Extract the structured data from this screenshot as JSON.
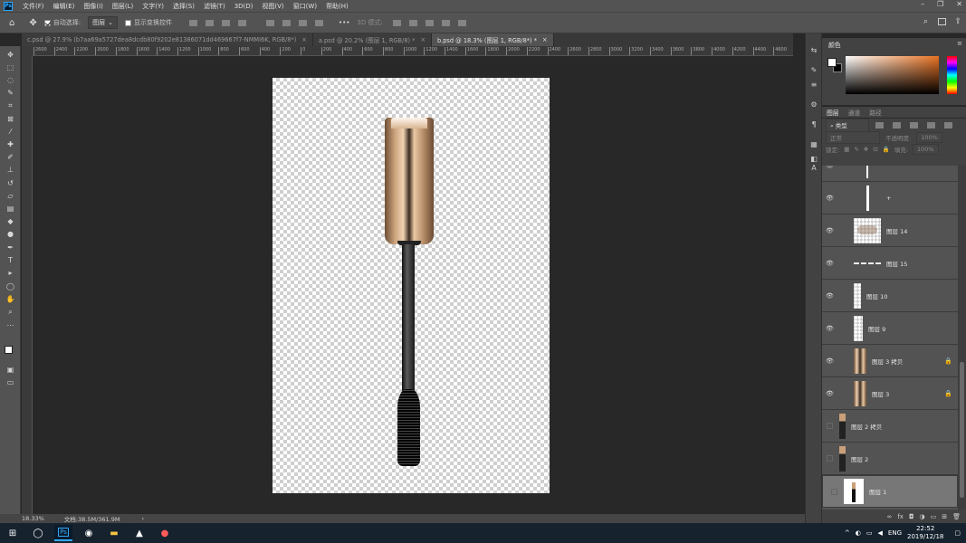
{
  "app": {
    "logo": "Ps"
  },
  "menu": [
    "文件(F)",
    "编辑(E)",
    "图像(I)",
    "图层(L)",
    "文字(Y)",
    "选择(S)",
    "滤镜(T)",
    "3D(D)",
    "视图(V)",
    "窗口(W)",
    "帮助(H)"
  ],
  "window_controls": {
    "minimize": "–",
    "restore": "❐",
    "close": "✕"
  },
  "options": {
    "auto_select_label": "自动选择:",
    "auto_select_value": "图层",
    "show_transform_label": "显示变换控件",
    "mode_3d_label": "3D 模式:",
    "more": "•••"
  },
  "tabs": [
    {
      "label": "c.psd @ 27.9% (b7aa69a5727dea8dcdb80f9202e81386071dd469667f7-NMMI6K, RGB/8*)",
      "close": "×"
    },
    {
      "label": "a.psd @ 20.2% (图层 1, RGB/8) *",
      "close": "×"
    },
    {
      "label": "b.psd @ 18.3% (图层 1, RGB/8*) *",
      "close": "×"
    }
  ],
  "ruler_ticks": [
    "2600",
    "2400",
    "2200",
    "2000",
    "1800",
    "1600",
    "1400",
    "1200",
    "1000",
    "800",
    "600",
    "400",
    "200",
    "0",
    "200",
    "400",
    "600",
    "800",
    "1000",
    "1200",
    "1400",
    "1600",
    "1800",
    "2000",
    "2200",
    "2400",
    "2600",
    "2800",
    "3000",
    "3200",
    "3400",
    "3600",
    "3800",
    "4000",
    "4200",
    "4400",
    "4600",
    "4800"
  ],
  "status": {
    "zoom": "18.33%",
    "doc_size": "文档:38.5M/361.9M",
    "arrow": "›"
  },
  "color_panel": {
    "title": "颜色",
    "fg": "#ffffff",
    "bg": "#000000",
    "hue_color": "#e87222"
  },
  "layers_panel": {
    "tabs": [
      "图层",
      "通道",
      "路径"
    ],
    "filter_label": "类型",
    "blend_mode": "正常",
    "opacity_label": "不透明度:",
    "opacity_value": "100%",
    "lock_label": "锁定:",
    "fill_label": "填充:",
    "fill_value": "100%",
    "layers": [
      {
        "name": "",
        "visible": true,
        "locked": false,
        "thumb": "line"
      },
      {
        "name": "+",
        "visible": true,
        "locked": false,
        "thumb": "line"
      },
      {
        "name": "图层 14",
        "visible": true,
        "locked": false,
        "thumb": "shadow"
      },
      {
        "name": "图层 15",
        "visible": true,
        "locked": false,
        "thumb": "dash"
      },
      {
        "name": "图层 10",
        "visible": true,
        "locked": false,
        "thumb": "narrow"
      },
      {
        "name": "图层 9",
        "visible": true,
        "locked": false,
        "thumb": "narrow"
      },
      {
        "name": "图层 3 拷贝",
        "visible": true,
        "locked": true,
        "thumb": "gold"
      },
      {
        "name": "图层 3",
        "visible": true,
        "locked": true,
        "thumb": "gold"
      },
      {
        "name": "图层 2 拷贝",
        "visible": false,
        "locked": false,
        "thumb": "wand"
      },
      {
        "name": "图层 2",
        "visible": false,
        "locked": false,
        "thumb": "wand"
      },
      {
        "name": "图层 1",
        "visible": false,
        "locked": false,
        "thumb": "mascara",
        "selected": true
      }
    ]
  },
  "taskbar": {
    "time": "22:52",
    "date": "2019/12/18",
    "lang": "ENG",
    "apps": [
      "windows-start",
      "search",
      "photoshop",
      "browser",
      "file-explorer",
      "photos",
      "qq"
    ]
  }
}
